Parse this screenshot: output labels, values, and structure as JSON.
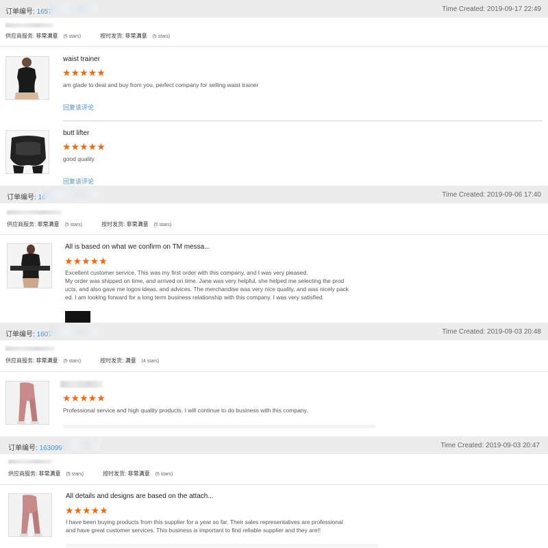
{
  "labels": {
    "order_label": "订单编号: ",
    "supplier_service": "供应商服务: ",
    "on_time": "按时发货: ",
    "reply": "回复该评论"
  },
  "orders": [
    {
      "order_prefix": "1657",
      "time": "Time Created: 2019-09-17 22:49",
      "service_value": "非常满意",
      "service_stars": "(5 stars)",
      "ship_value": "非常满意",
      "ship_stars": "(5 stars)",
      "items": [
        {
          "title": "waist trainer",
          "stars": "★★★★★",
          "text": "am glade to deal and buy from you, perfect company for selling waist trainer"
        },
        {
          "title": "butt lifter",
          "stars": "★★★★★",
          "text": "good quality"
        }
      ]
    },
    {
      "order_prefix": "16",
      "time": "Time Created: 2019-09-06 17:40",
      "service_value": "非常满意",
      "service_stars": "(5 stars)",
      "ship_value": "非常满意",
      "ship_stars": "(5 stars)",
      "items": [
        {
          "title": "All is based on what we confirm on TM messa...",
          "stars": "★★★★★",
          "lines": [
            "Excellent customer service, This was my first order with this company, and I was very pleased.",
            "My order was shipped on time, and arrived on time. Jane was very helpful, she helped me selecting the prod",
            "ucts, and also gave me logos ideas, and advices. The merchandise was very nice quality, and was nicely pack",
            "ed. I am looking forward for a long term business relationship with this company. I was very satisfied."
          ]
        }
      ]
    },
    {
      "order_prefix": "1607",
      "time": "Time Created: 2019-09-03 20:48",
      "service_value": "非常满意",
      "service_stars": "(5 stars)",
      "ship_value": "满意",
      "ship_stars": "(4 stars)",
      "items": [
        {
          "title": "",
          "stars": "★★★★★",
          "text": "Professional service and high quality products.  I will continue to do business with this company."
        }
      ]
    },
    {
      "order_prefix": "163099",
      "time": "Time Created: 2019-09-03 20:47",
      "service_value": "非常满意",
      "service_stars": "(5 stars)",
      "ship_value": "非常满意",
      "ship_stars": "(5 stars)",
      "items": [
        {
          "title": "All details and designs are based on the attach...",
          "stars": "★★★★★",
          "lines": [
            "I have been buying products from this supplier for a year so far.  Their sales representatives are professional",
            "and have great customer services. This business is important to find reliable supplier and they are!!"
          ]
        }
      ]
    }
  ]
}
